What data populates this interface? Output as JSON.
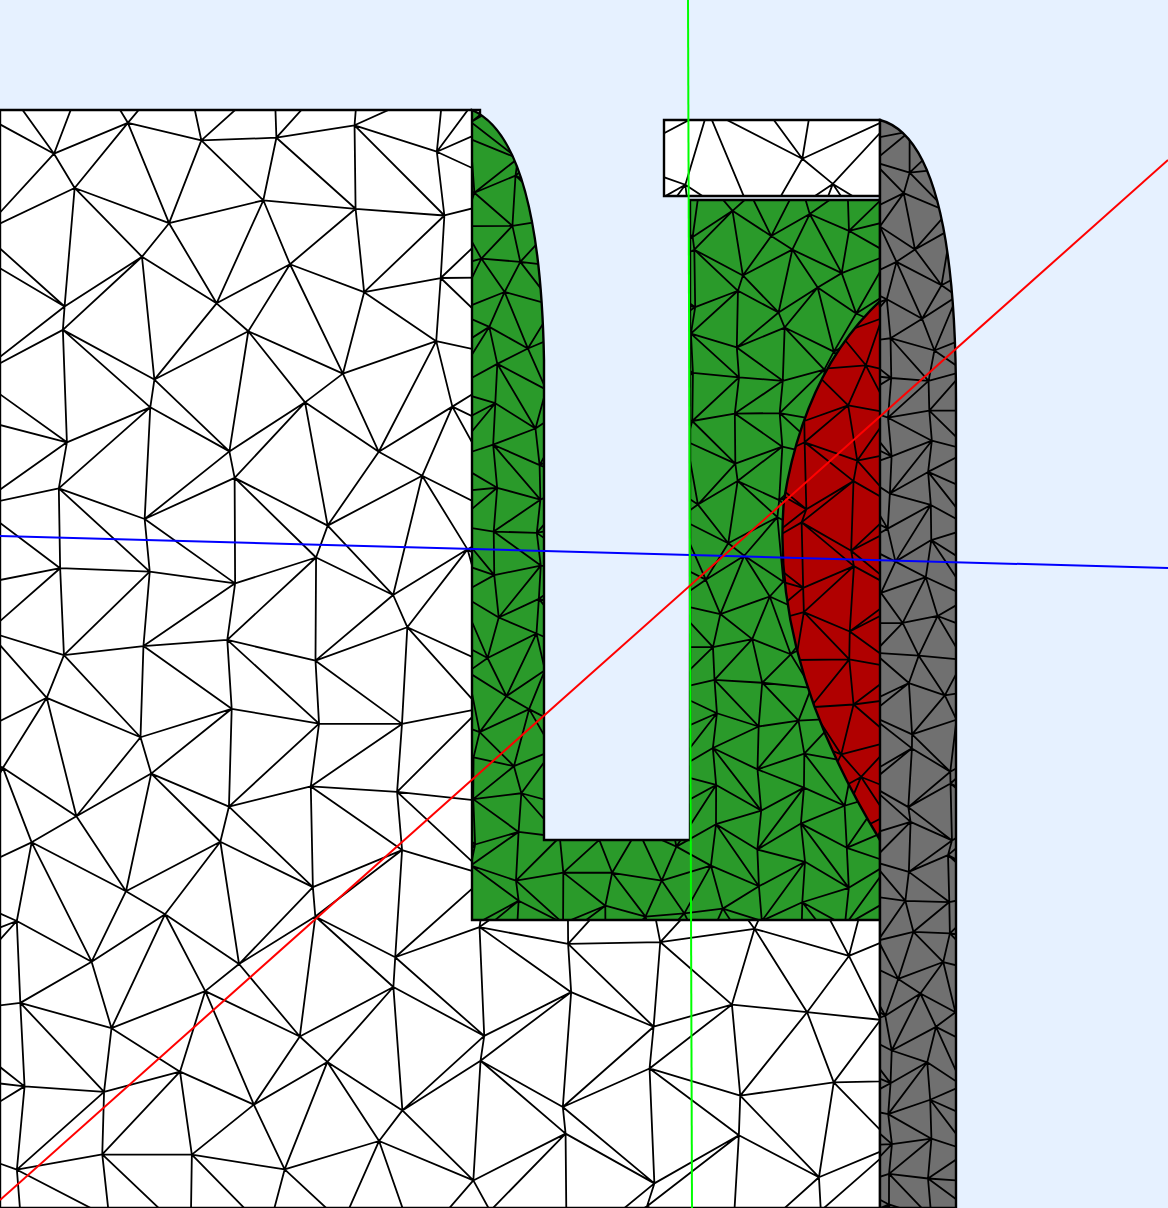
{
  "viewport": {
    "regions": [
      {
        "kind": "outer",
        "color": "#ffffff"
      },
      {
        "kind": "channel",
        "color": "#2a9a2a"
      },
      {
        "kind": "lens",
        "color": "#b00000"
      },
      {
        "kind": "strip",
        "color": "#707070"
      }
    ],
    "axes": [
      {
        "kind": "x",
        "color": "#0000ff"
      },
      {
        "kind": "y",
        "color": "#00ff00"
      },
      {
        "kind": "z",
        "color": "#ff0000"
      }
    ]
  }
}
